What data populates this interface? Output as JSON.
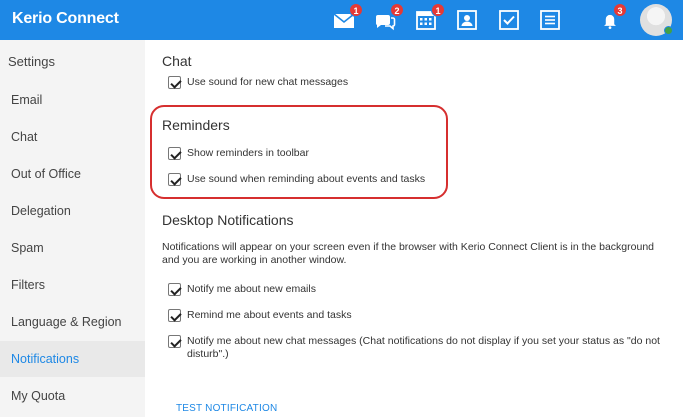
{
  "app": {
    "title": "Kerio Connect"
  },
  "toolbar": {
    "icons": [
      {
        "name": "mail-icon",
        "badge": "1"
      },
      {
        "name": "chat-icon",
        "badge": "2"
      },
      {
        "name": "calendar-icon",
        "badge": "1"
      },
      {
        "name": "contacts-icon",
        "badge": ""
      },
      {
        "name": "tasks-icon",
        "badge": ""
      },
      {
        "name": "notes-icon",
        "badge": ""
      },
      {
        "name": "bell-icon",
        "badge": "3"
      }
    ],
    "status_color": "#43a047"
  },
  "sidebar": {
    "title": "Settings",
    "items": [
      {
        "label": "Email"
      },
      {
        "label": "Chat"
      },
      {
        "label": "Out of Office"
      },
      {
        "label": "Delegation"
      },
      {
        "label": "Spam"
      },
      {
        "label": "Filters"
      },
      {
        "label": "Language & Region"
      },
      {
        "label": "Notifications"
      },
      {
        "label": "My Quota"
      }
    ],
    "active": "Notifications"
  },
  "main": {
    "chat": {
      "title": "Chat",
      "options": [
        {
          "label": "Use sound for new chat messages",
          "checked": true
        }
      ]
    },
    "reminders": {
      "title": "Reminders",
      "options": [
        {
          "label": "Show reminders in toolbar",
          "checked": true
        },
        {
          "label": "Use sound when reminding about events and tasks",
          "checked": true
        }
      ]
    },
    "desktop": {
      "title": "Desktop Notifications",
      "description": "Notifications will appear on your screen even if the browser with Kerio Connect Client is in the background and you are working in another window.",
      "options": [
        {
          "label": "Notify me about new emails",
          "checked": true
        },
        {
          "label": "Remind me about events and tasks",
          "checked": true
        },
        {
          "label": "Notify me about new chat messages (Chat notifications do not display if you set your status as \"do not disturb\".)",
          "checked": true
        }
      ]
    },
    "test_button": "TEST NOTIFICATION"
  },
  "colors": {
    "accent": "#1e88e5",
    "highlight": "#d62f2f",
    "badge": "#e53935"
  }
}
